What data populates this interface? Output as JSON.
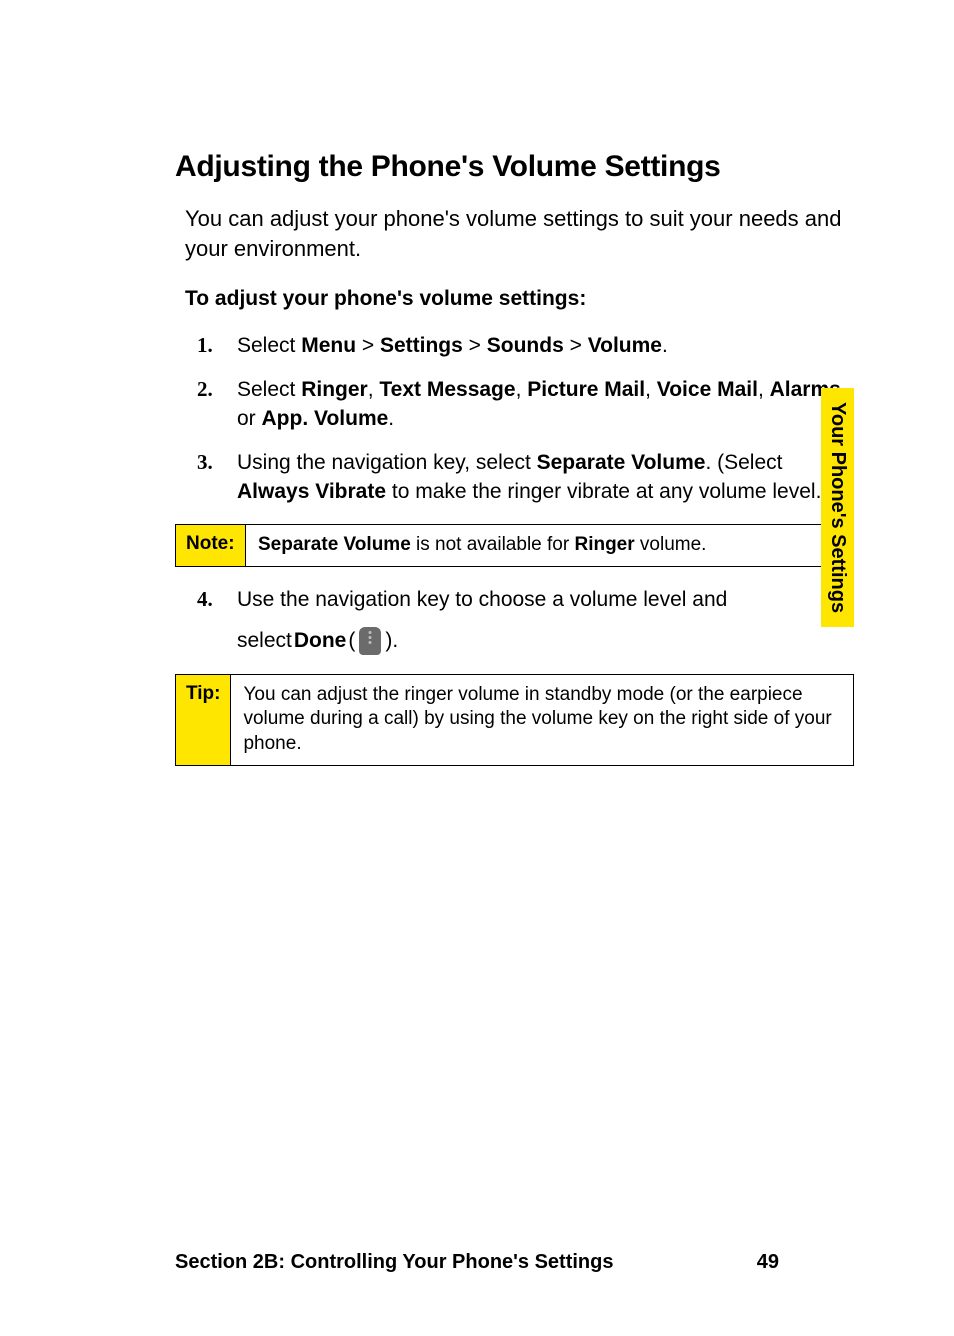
{
  "heading": "Adjusting the Phone's Volume Settings",
  "intro": "You can adjust your phone's volume settings to suit your needs and your environment.",
  "subheading": "To adjust your phone's volume settings:",
  "steps": {
    "s1": {
      "prefix": "Select ",
      "menu": "Menu",
      "sep": " > ",
      "settings": "Settings",
      "sounds": "Sounds",
      "volume": "Volume",
      "suffix": "."
    },
    "s2": {
      "prefix": "Select ",
      "ringer": "Ringer",
      "c1": ", ",
      "text_message": "Text Message",
      "c2": ", ",
      "picture_mail": "Picture Mail",
      "c3": ", ",
      "voice_mail": "Voice Mail",
      "c4": ", ",
      "alarms": "Alarms",
      "c5": ", or ",
      "app_volume": "App. Volume",
      "suffix": "."
    },
    "s3": {
      "part1": "Using the navigation key, select ",
      "sep_vol": "Separate Volume",
      "part2": ". (Select ",
      "always_vibrate": "Always Vibrate",
      "part3": " to make the ringer vibrate at any volume level.)"
    },
    "s4": {
      "line1": "Use the navigation key to choose a volume level and ",
      "line2a": "select ",
      "done": "Done",
      "line2b": " (",
      "line2c": ")."
    }
  },
  "note": {
    "label": "Note:",
    "b1": "Separate Volume",
    "t1": " is not available for ",
    "b2": "Ringer",
    "t2": " volume."
  },
  "tip": {
    "label": "Tip:",
    "text": "You can adjust the ringer volume in standby mode (or the earpiece volume during a call) by using the volume key on the right side of your phone."
  },
  "side_tab": "Your Phone's Settings",
  "footer": {
    "section": "Section 2B: Controlling Your Phone's Settings",
    "page": "49"
  }
}
